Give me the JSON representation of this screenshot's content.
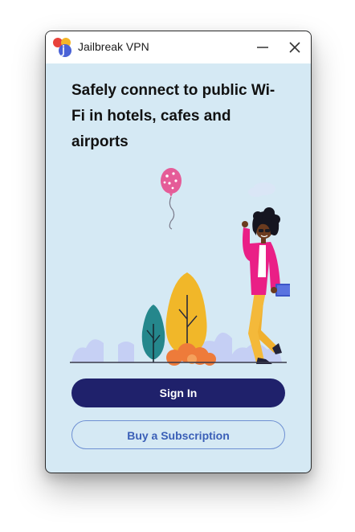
{
  "window": {
    "title": "Jailbreak VPN",
    "controls": {
      "minimize_icon": "minimize-icon",
      "close_icon": "close-icon"
    }
  },
  "onboarding": {
    "headline": "Safely connect to public Wi-Fi in hotels, cafes and airports",
    "illustration": "woman-with-balloon-illustration"
  },
  "actions": {
    "sign_in_label": "Sign In",
    "buy_subscription_label": "Buy a Subscription"
  },
  "colors": {
    "background": "#d5e9f4",
    "primary_button": "#1f216b",
    "secondary_button_text": "#3a5fb7",
    "secondary_button_border": "#6d8fd2"
  }
}
